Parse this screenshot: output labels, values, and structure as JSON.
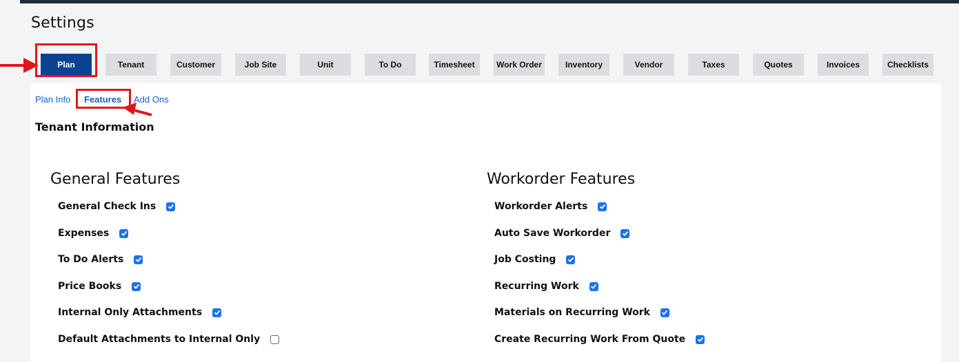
{
  "page": {
    "title": "Settings"
  },
  "tabs": [
    {
      "label": "Plan",
      "active": true
    },
    {
      "label": "Tenant"
    },
    {
      "label": "Customer"
    },
    {
      "label": "Job Site"
    },
    {
      "label": "Unit"
    },
    {
      "label": "To Do"
    },
    {
      "label": "Timesheet"
    },
    {
      "label": "Work Order"
    },
    {
      "label": "Inventory"
    },
    {
      "label": "Vendor"
    },
    {
      "label": "Taxes"
    },
    {
      "label": "Quotes"
    },
    {
      "label": "Invoices"
    },
    {
      "label": "Checklists"
    }
  ],
  "subtabs": [
    {
      "label": "Plan Info"
    },
    {
      "label": "Features",
      "active": true
    },
    {
      "label": "Add Ons"
    }
  ],
  "section": {
    "title": "Tenant Information"
  },
  "general": {
    "title": "General Features",
    "items": [
      {
        "label": "General Check Ins",
        "checked": true
      },
      {
        "label": "Expenses",
        "checked": true
      },
      {
        "label": "To Do Alerts",
        "checked": true
      },
      {
        "label": "Price Books",
        "checked": true
      },
      {
        "label": "Internal Only Attachments",
        "checked": true
      },
      {
        "label": "Default Attachments to Internal Only",
        "checked": false
      }
    ]
  },
  "workorder": {
    "title": "Workorder Features",
    "items": [
      {
        "label": "Workorder Alerts",
        "checked": true
      },
      {
        "label": "Auto Save Workorder",
        "checked": true
      },
      {
        "label": "Job Costing",
        "checked": true
      },
      {
        "label": "Recurring Work",
        "checked": true
      },
      {
        "label": "Materials on Recurring Work",
        "checked": true
      },
      {
        "label": "Create Recurring Work From Quote",
        "checked": true
      }
    ]
  },
  "colors": {
    "accent": "#0b4393",
    "link": "#1660c8",
    "highlight": "#e0161b",
    "checkbox": "#1a73e8"
  }
}
